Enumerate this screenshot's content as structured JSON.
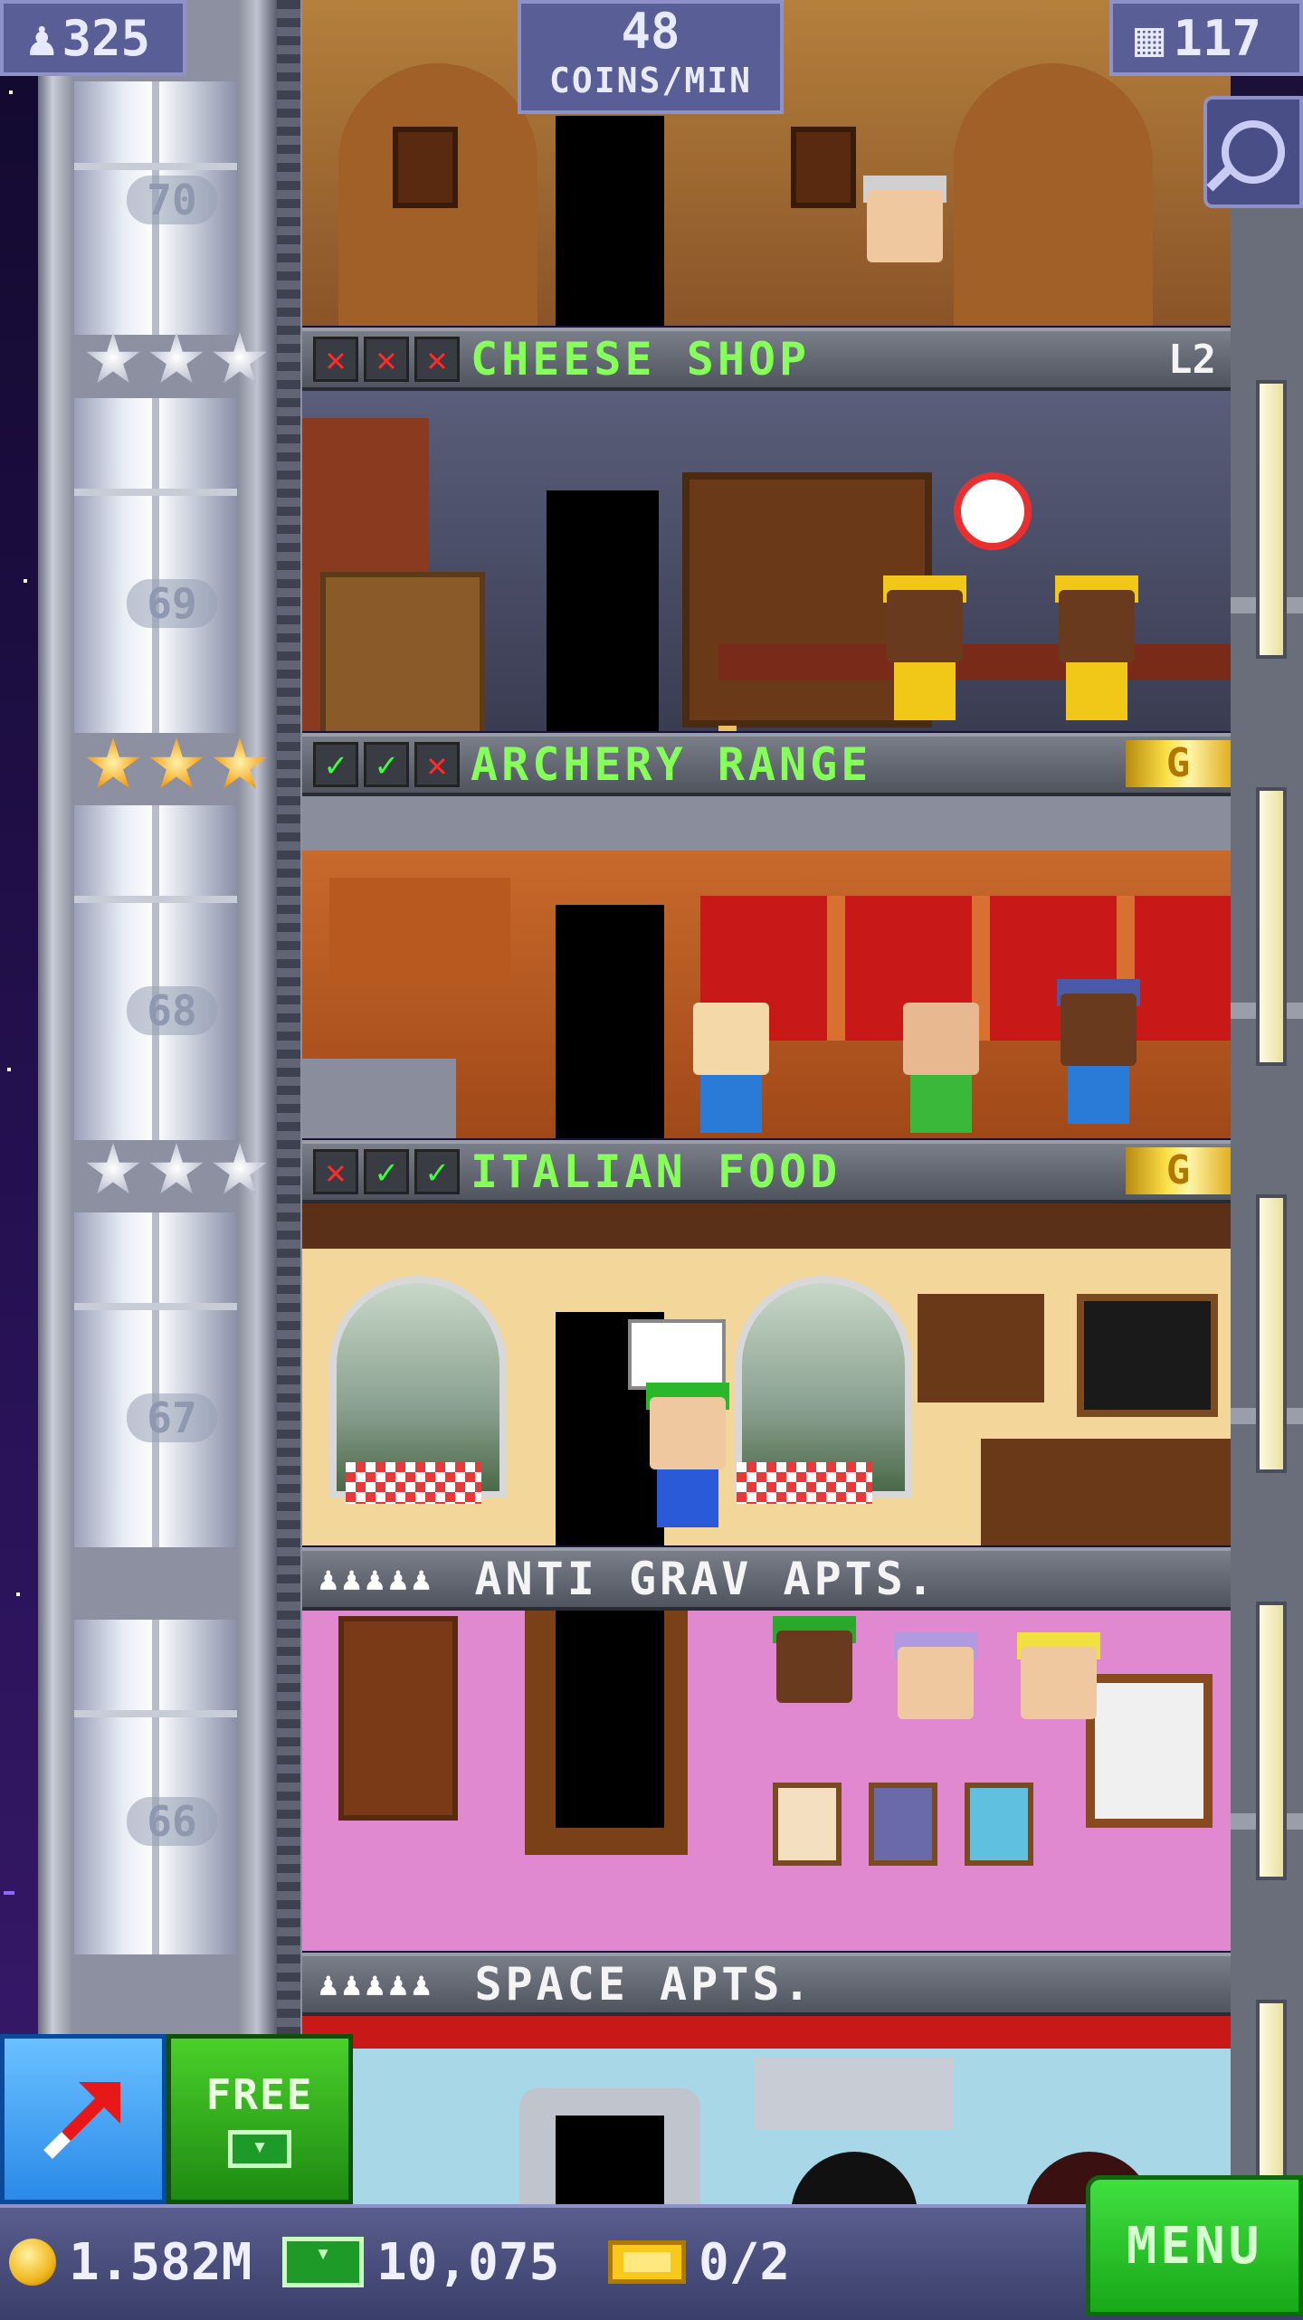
{
  "hud": {
    "population": "325",
    "coins_per_min_value": "48",
    "coins_per_min_label": "COINS/MIN",
    "floors_count": "117"
  },
  "elevator": {
    "floor_numbers": [
      "70",
      "69",
      "68",
      "67",
      "66"
    ]
  },
  "floors": [
    {
      "name": "CHEESE SHOP",
      "type": "retail",
      "status": [
        "red-x",
        "red-x",
        "red-x"
      ],
      "level_badge": "L2",
      "stars": "silver"
    },
    {
      "name": "ARCHERY RANGE",
      "type": "recreation",
      "status": [
        "green-check",
        "green-check",
        "red-x"
      ],
      "gold_badge": "G",
      "stars": "gold"
    },
    {
      "name": "ITALIAN FOOD",
      "type": "food",
      "status": [
        "red-x",
        "green-check",
        "green-check"
      ],
      "gold_badge": "G",
      "stars": "silver"
    },
    {
      "name": "ANTI GRAV APTS.",
      "type": "residential",
      "residents_icon": "person-icons-5"
    },
    {
      "name": "SPACE APTS.",
      "type": "residential",
      "residents_icon": "person-icons-5"
    }
  ],
  "buttons": {
    "free_label": "FREE",
    "menu_label": "MENU"
  },
  "bottom_bar": {
    "coins": "1.582M",
    "bux": "10,075",
    "vip": "0/2"
  },
  "colors": {
    "accent_green": "#86ff5a",
    "hud_purple": "#5a5e96",
    "menu_green": "#18a818"
  }
}
